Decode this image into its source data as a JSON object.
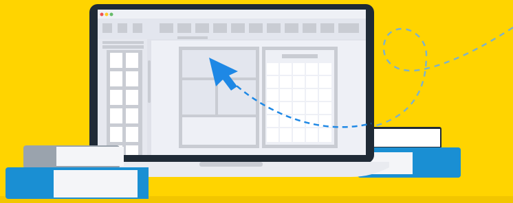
{
  "scene": {
    "background_color": "#ffd400",
    "laptop_color": "#1f2a36",
    "screen_bg_color": "#eef0f6",
    "ui_gray_color": "#c9ccd3",
    "arrow_color": "#1e88e5",
    "book_blue_color": "#1a8fd3",
    "book_gray_color": "#9aa3ad",
    "icons": [
      "mouse-pointer-icon",
      "window-dot-red",
      "window-dot-yellow",
      "window-dot-green"
    ]
  }
}
